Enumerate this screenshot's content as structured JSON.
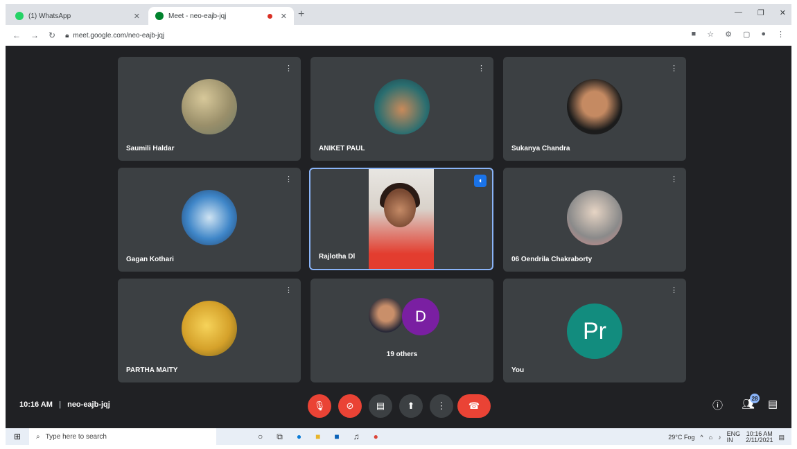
{
  "browser": {
    "tabs": [
      {
        "label": "(1) WhatsApp",
        "favicon_color": "#25d366"
      },
      {
        "label": "Meet - neo-eajb-jqj",
        "favicon_color": "#00832d"
      }
    ],
    "url": "meet.google.com/neo-eajb-jqj"
  },
  "participants": [
    {
      "name": "Saumili Haldar",
      "avatar": "photo"
    },
    {
      "name": "ANIKET PAUL",
      "avatar": "photo"
    },
    {
      "name": "Sukanya Chandra",
      "avatar": "photo"
    },
    {
      "name": "Gagan Kothari",
      "avatar": "photo"
    },
    {
      "name": "Rajlotha Dl",
      "avatar": "video",
      "speaking": true
    },
    {
      "name": "06 Oendrila Chakraborty",
      "avatar": "photo"
    },
    {
      "name": "PARTHA MAITY",
      "avatar": "photo"
    },
    {
      "name": "19 others",
      "avatar": "group",
      "initial": "D"
    },
    {
      "name": "You",
      "avatar": "initial",
      "initial": "Pr",
      "color": "#128c7e"
    }
  ],
  "meeting": {
    "time": "10:16 AM",
    "separator": "|",
    "code": "neo-eajb-jqj"
  },
  "controls": {
    "people_count": "28"
  },
  "taskbar": {
    "search_placeholder": "Type here to search",
    "weather": "29°C Fog",
    "language": "ENG",
    "region": "IN",
    "clock_time": "10:16 AM",
    "clock_date": "2/11/2021"
  }
}
